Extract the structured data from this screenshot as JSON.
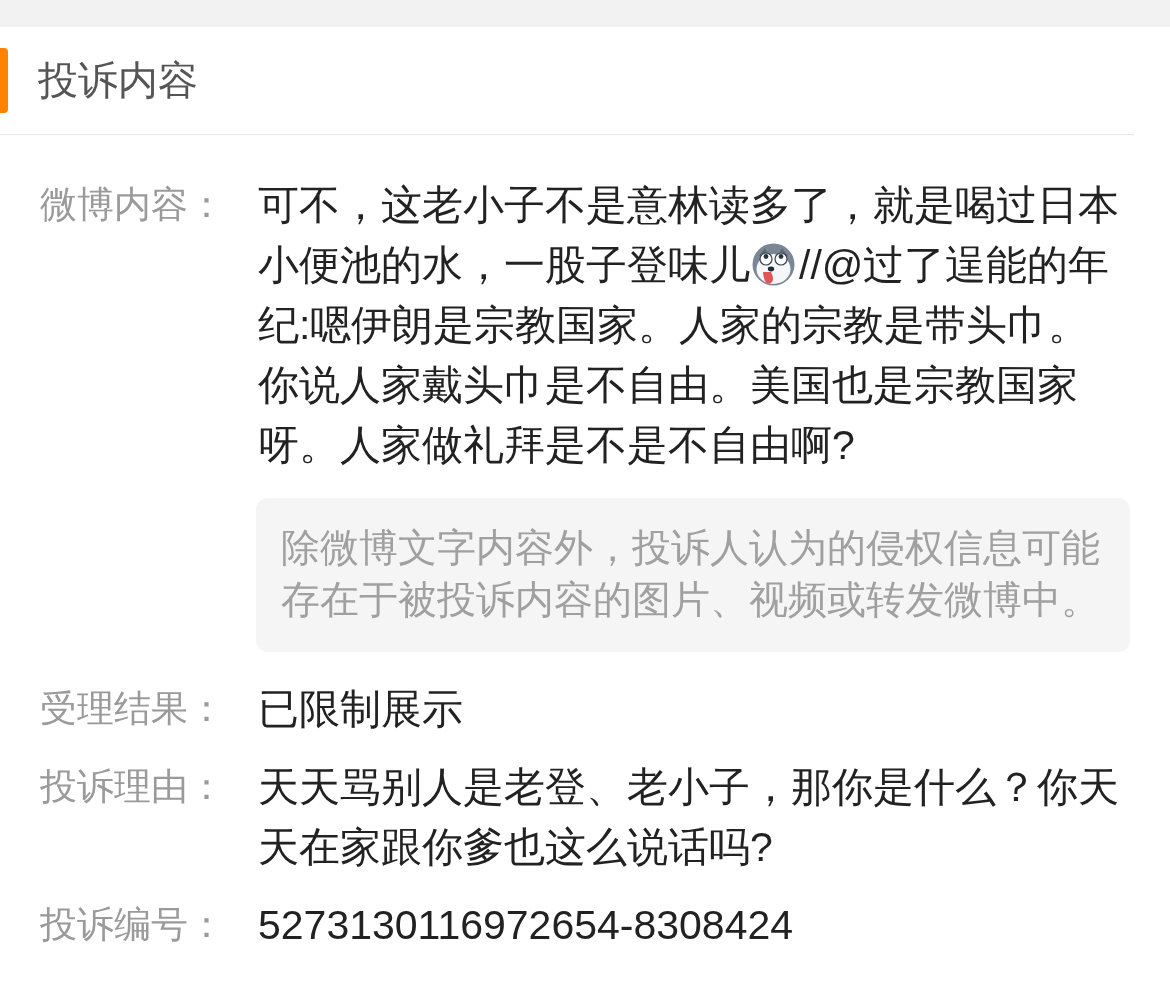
{
  "header": {
    "title": "投诉内容"
  },
  "fields": [
    {
      "kind": "content",
      "label": "微博内容：",
      "segments": [
        {
          "kind": "text",
          "text": "可不，这老小子不是意林读多了，就是喝过日本小便池的水，一股子登味儿"
        },
        {
          "kind": "emoji"
        },
        {
          "kind": "text",
          "text": "//@过了逞能的年纪:嗯伊朗是宗教国家。人家的宗教是带头巾。你说人家戴头巾是不自由。美国也是宗教国家呀。人家做礼拜是不是不自由啊?"
        }
      ],
      "note": "除微博文字内容外，投诉人认为的侵权信息可能存在于被投诉内容的图片、视频或转发微博中。"
    },
    {
      "kind": "text",
      "label": "受理结果：",
      "value": "已限制展示"
    },
    {
      "kind": "text",
      "label": "投诉理由：",
      "value": "天天骂别人是老登、老小子，那你是什么？你天天在家跟你爹也这么说话吗?"
    },
    {
      "kind": "text",
      "label": "投诉编号：",
      "value": "5273130116972654-8308424"
    }
  ]
}
